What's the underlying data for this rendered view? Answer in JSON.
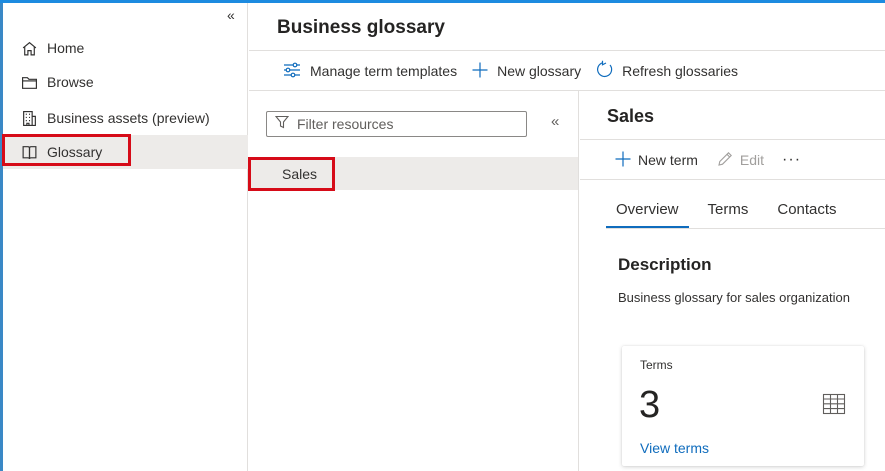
{
  "sidebar": {
    "collapse_glyph": "«",
    "items": [
      {
        "label": "Home",
        "icon": "home-icon"
      },
      {
        "label": "Browse",
        "icon": "folder-icon"
      },
      {
        "label": "Business assets (preview)",
        "icon": "building-icon"
      },
      {
        "label": "Glossary",
        "icon": "book-icon",
        "selected": true
      }
    ]
  },
  "header": {
    "title": "Business glossary"
  },
  "toolbar": {
    "manage_templates": "Manage term templates",
    "new_glossary": "New glossary",
    "refresh_glossaries": "Refresh glossaries"
  },
  "filter": {
    "placeholder": "Filter resources",
    "collapse_glyph": "«"
  },
  "glossaries": [
    {
      "name": "Sales",
      "selected": true
    }
  ],
  "detail": {
    "title": "Sales",
    "new_term": "New term",
    "edit": "Edit",
    "more": "···",
    "tabs": [
      {
        "label": "Overview",
        "active": true
      },
      {
        "label": "Terms",
        "active": false
      },
      {
        "label": "Contacts",
        "active": false
      }
    ],
    "description_heading": "Description",
    "description_text": "Business glossary for sales organization",
    "terms_card": {
      "label": "Terms",
      "count": "3",
      "link": "View terms"
    }
  },
  "colors": {
    "accent": "#0f6cbd",
    "highlight": "#d60b18",
    "selected_bg": "#edebe9",
    "topbar": "#1c8be0"
  }
}
